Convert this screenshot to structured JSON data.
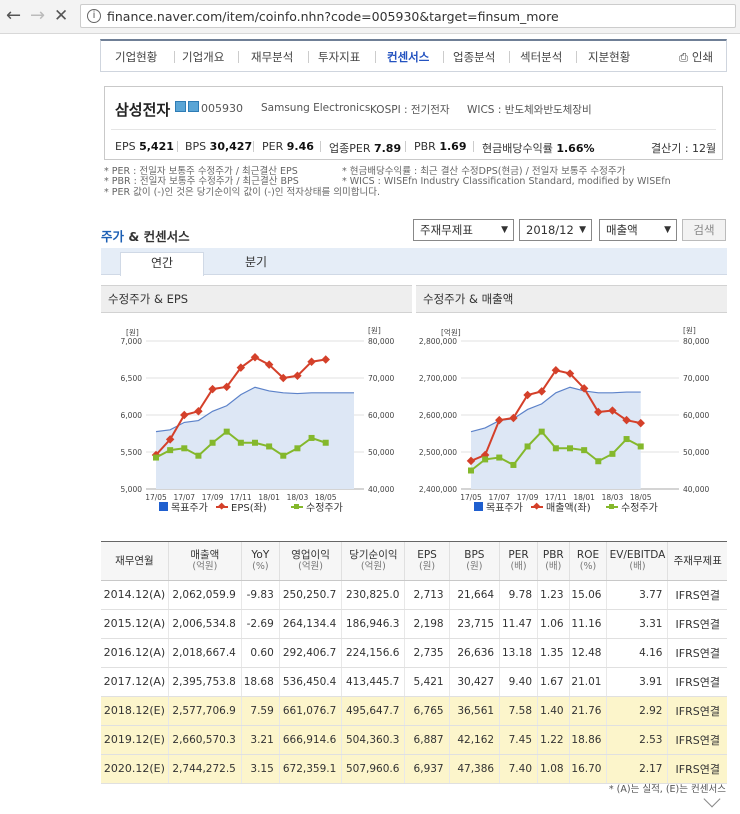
{
  "browser": {
    "url": "finance.naver.com/item/coinfo.nhn?code=005930&target=finsum_more"
  },
  "nav": [
    "기업현황",
    "기업개요",
    "재무분석",
    "투자지표",
    "컨센서스",
    "업종분석",
    "섹터분석",
    "지분현황"
  ],
  "nav_print": "인쇄",
  "company": {
    "name": "삼성전자",
    "code": "005930",
    "eng": "Samsung Electronics",
    "market": "KOSPI : 전기전자",
    "wics": "WICS : 반도체와반도체장비",
    "settle": "결산기 : 12월",
    "eps_label": "EPS",
    "eps": "5,421",
    "bps_label": "BPS",
    "bps": "30,427",
    "per_label": "PER",
    "per": "9.46",
    "iper_label": "업종PER",
    "iper": "7.89",
    "pbr_label": "PBR",
    "pbr": "1.69",
    "div_label": "현금배당수익률",
    "div": "1.66%"
  },
  "notes": [
    "* PER : 전일자 보통주 수정주가 / 최근결산 EPS",
    "* PBR : 전일자 보통주 수정주가 / 최근결산 BPS",
    "* PER 값이 (-)인 것은 당기순이익 값이 (-)인 적자상태를 의미합니다.",
    "* 현금배당수익률 : 최근 결산 수정DPS(현금) / 전일자 보통주 수정주가",
    "* WICS : WISEfn Industry Classification Standard, modified by WISEfn"
  ],
  "consensus": {
    "title_a": "주가",
    "title_b": " & 컨센서스",
    "sel1": "주재무제표",
    "sel2": "2018/12",
    "sel3": "매출액",
    "search": "검색",
    "tab_year": "연간",
    "tab_quarter": "분기"
  },
  "chart_data": [
    {
      "type": "line",
      "title": "수정주가 & EPS",
      "ylabel_left": "[원]",
      "ylabel_right": "[원]",
      "ylim_left": [
        5000,
        7000
      ],
      "ylim_right": [
        40000,
        80000
      ],
      "left_ticks": [
        "7,000",
        "6,500",
        "6,000",
        "5,500",
        "5,000"
      ],
      "right_ticks": [
        "80,000",
        "70,000",
        "60,000",
        "50,000",
        "40,000"
      ],
      "x_ticks": [
        "17/05",
        "17/07",
        "17/09",
        "17/11",
        "18/01",
        "18/03",
        "18/05"
      ],
      "n": 15,
      "series": [
        {
          "name": "목표주가",
          "axis": "right",
          "style": "area",
          "color": "#5c82c9",
          "values": [
            55500,
            56000,
            58000,
            58500,
            61000,
            62500,
            65500,
            67500,
            66500,
            66000,
            65800,
            66000,
            66000,
            66000,
            66000
          ]
        },
        {
          "name": "EPS(좌)",
          "axis": "left",
          "color": "#d4402a",
          "values": [
            5460,
            5670,
            6000,
            6050,
            6350,
            6380,
            6640,
            6780,
            6680,
            6500,
            6530,
            6720,
            6750,
            null,
            null
          ]
        },
        {
          "name": "수정주가",
          "axis": "right",
          "color": "#84b82c",
          "values": [
            48500,
            50500,
            51000,
            49000,
            52500,
            55500,
            52500,
            52500,
            51500,
            49000,
            51000,
            53800,
            52500,
            null,
            null
          ]
        }
      ],
      "legend": [
        "목표주가",
        "EPS(좌)",
        "수정주가"
      ]
    },
    {
      "type": "line",
      "title": "수정주가 & 매출액",
      "ylabel_left": "[억원]",
      "ylabel_right": "[원]",
      "ylim_left": [
        2400000,
        2800000
      ],
      "ylim_right": [
        40000,
        80000
      ],
      "left_ticks": [
        "2,800,000",
        "2,700,000",
        "2,600,000",
        "2,500,000",
        "2,400,000"
      ],
      "right_ticks": [
        "80,000",
        "70,000",
        "60,000",
        "50,000",
        "40,000"
      ],
      "x_ticks": [
        "17/05",
        "17/07",
        "17/09",
        "17/11",
        "18/01",
        "18/03",
        "18/05"
      ],
      "n": 15,
      "series": [
        {
          "name": "목표주가",
          "axis": "right",
          "style": "area",
          "color": "#5c82c9",
          "values": [
            55500,
            56500,
            58500,
            59000,
            61500,
            63000,
            66000,
            67500,
            66500,
            66000,
            66000,
            66200,
            66200,
            null,
            null
          ]
        },
        {
          "name": "매출액(좌)",
          "axis": "left",
          "color": "#d4402a",
          "values": [
            2476000,
            2492000,
            2586000,
            2592000,
            2654000,
            2664000,
            2721000,
            2712000,
            2672000,
            2608000,
            2612000,
            2586000,
            2578000,
            null,
            null
          ]
        },
        {
          "name": "수정주가",
          "axis": "right",
          "color": "#84b82c",
          "values": [
            45000,
            48000,
            48500,
            46500,
            51500,
            55500,
            51000,
            51000,
            50500,
            47500,
            49500,
            53500,
            51500,
            null,
            null
          ]
        }
      ],
      "legend": [
        "목표주가",
        "매출액(좌)",
        "수정주가"
      ]
    }
  ],
  "table": {
    "headers": [
      [
        "재무연월",
        ""
      ],
      [
        "매출액",
        "(억원)"
      ],
      [
        "YoY",
        "(%)"
      ],
      [
        "영업이익",
        "(억원)"
      ],
      [
        "당기순이익",
        "(억원)"
      ],
      [
        "EPS",
        "(원)"
      ],
      [
        "BPS",
        "(원)"
      ],
      [
        "PER",
        "(배)"
      ],
      [
        "PBR",
        "(배)"
      ],
      [
        "ROE",
        "(%)"
      ],
      [
        "EV/EBITDA",
        "(배)"
      ],
      [
        "주재무제표",
        ""
      ]
    ],
    "rows": [
      [
        "2014.12(A)",
        "2,062,059.9",
        "-9.83",
        "250,250.7",
        "230,825.0",
        "2,713",
        "21,664",
        "9.78",
        "1.23",
        "15.06",
        "3.77",
        "IFRS연결"
      ],
      [
        "2015.12(A)",
        "2,006,534.8",
        "-2.69",
        "264,134.4",
        "186,946.3",
        "2,198",
        "23,715",
        "11.47",
        "1.06",
        "11.16",
        "3.31",
        "IFRS연결"
      ],
      [
        "2016.12(A)",
        "2,018,667.4",
        "0.60",
        "292,406.7",
        "224,156.6",
        "2,735",
        "26,636",
        "13.18",
        "1.35",
        "12.48",
        "4.16",
        "IFRS연결"
      ],
      [
        "2017.12(A)",
        "2,395,753.8",
        "18.68",
        "536,450.4",
        "413,445.7",
        "5,421",
        "30,427",
        "9.40",
        "1.67",
        "21.01",
        "3.91",
        "IFRS연결"
      ],
      [
        "2018.12(E)",
        "2,577,706.9",
        "7.59",
        "661,076.7",
        "495,647.7",
        "6,765",
        "36,561",
        "7.58",
        "1.40",
        "21.76",
        "2.92",
        "IFRS연결"
      ],
      [
        "2019.12(E)",
        "2,660,570.3",
        "3.21",
        "666,914.6",
        "504,360.3",
        "6,887",
        "42,162",
        "7.45",
        "1.22",
        "18.86",
        "2.53",
        "IFRS연결"
      ],
      [
        "2020.12(E)",
        "2,744,272.5",
        "3.15",
        "672,359.1",
        "507,960.6",
        "6,937",
        "47,386",
        "7.40",
        "1.08",
        "16.70",
        "2.17",
        "IFRS연결"
      ]
    ]
  },
  "footnote": "* (A)는 실적, (E)는 컨센서스"
}
